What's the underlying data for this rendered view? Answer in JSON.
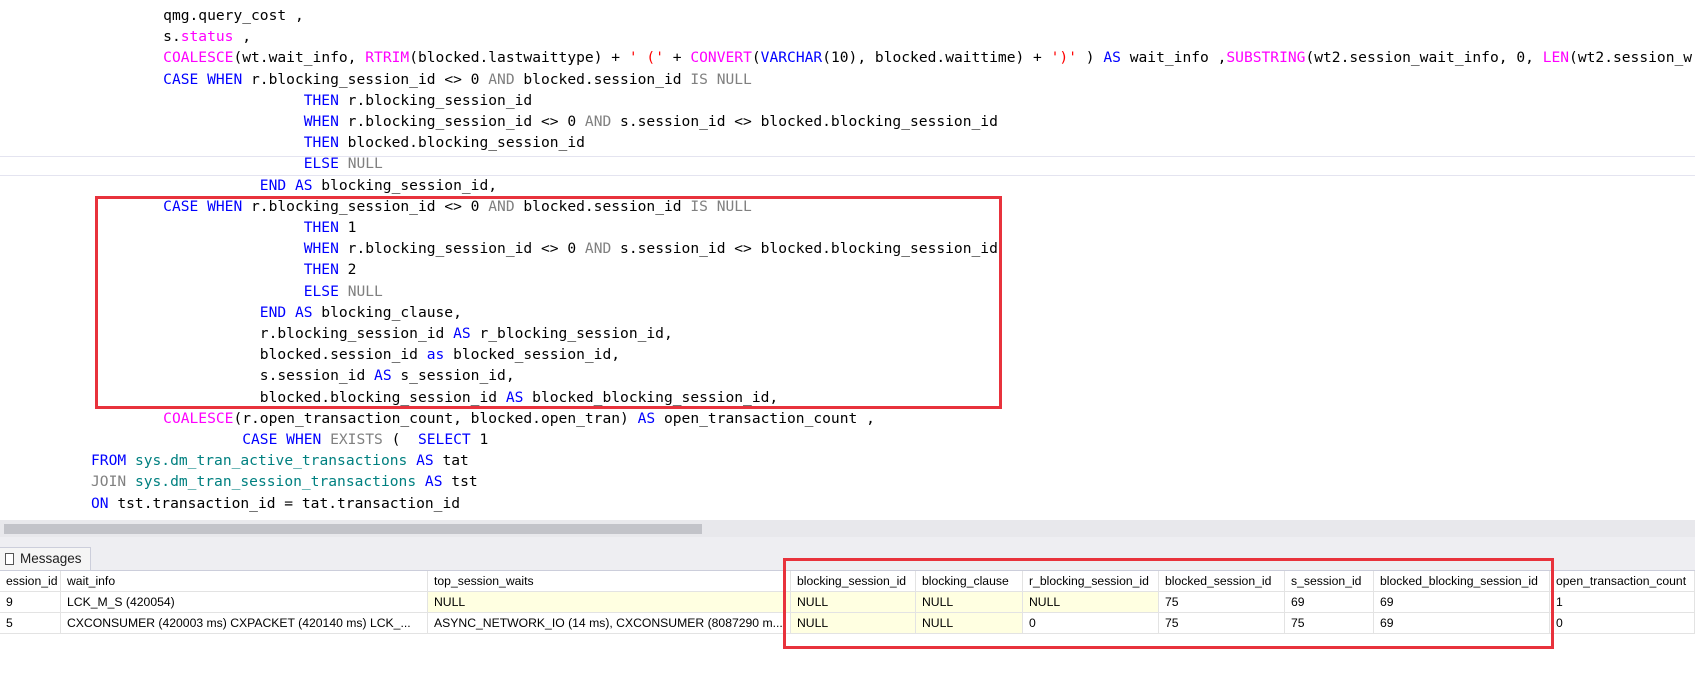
{
  "editor": {
    "lines": [
      [
        {
          "t": "    ",
          "c": "id"
        },
        {
          "t": "qmg.query_cost ,",
          "c": "id"
        }
      ],
      [
        {
          "t": "    ",
          "c": "id"
        },
        {
          "t": "s.",
          "c": "id"
        },
        {
          "t": "status",
          "c": "fn"
        },
        {
          "t": " ,",
          "c": "id"
        }
      ],
      [
        {
          "t": "    ",
          "c": "id"
        },
        {
          "t": "COALESCE",
          "c": "fn"
        },
        {
          "t": "(wt.wait_info, ",
          "c": "id"
        },
        {
          "t": "RTRIM",
          "c": "fn"
        },
        {
          "t": "(blocked.lastwaittype) + ",
          "c": "id"
        },
        {
          "t": "' ('",
          "c": "str"
        },
        {
          "t": " + ",
          "c": "id"
        },
        {
          "t": "CONVERT",
          "c": "fn"
        },
        {
          "t": "(",
          "c": "id"
        },
        {
          "t": "VARCHAR",
          "c": "kw"
        },
        {
          "t": "(10), blocked.waittime) + ",
          "c": "id"
        },
        {
          "t": "')'",
          "c": "str"
        },
        {
          "t": " ) ",
          "c": "id"
        },
        {
          "t": "AS",
          "c": "kw"
        },
        {
          "t": " wait_info ,",
          "c": "id"
        },
        {
          "t": "SUBSTRING",
          "c": "fn"
        },
        {
          "t": "(wt2.session_wait_info, 0, ",
          "c": "id"
        },
        {
          "t": "LEN",
          "c": "fn"
        },
        {
          "t": "(wt2.session_w",
          "c": "id"
        }
      ],
      [
        {
          "t": "    ",
          "c": "id"
        },
        {
          "t": "CASE WHEN",
          "c": "kw"
        },
        {
          "t": " r.blocking_session_id <> 0 ",
          "c": "id"
        },
        {
          "t": "AND",
          "c": "gray"
        },
        {
          "t": " blocked.session_id ",
          "c": "id"
        },
        {
          "t": "IS NULL",
          "c": "gray"
        }
      ],
      [
        {
          "t": "                    ",
          "c": "id"
        },
        {
          "t": "THEN",
          "c": "kw"
        },
        {
          "t": " r.blocking_session_id",
          "c": "id"
        }
      ],
      [
        {
          "t": "                    ",
          "c": "id"
        },
        {
          "t": "WHEN",
          "c": "kw"
        },
        {
          "t": " r.blocking_session_id <> 0 ",
          "c": "id"
        },
        {
          "t": "AND",
          "c": "gray"
        },
        {
          "t": " s.session_id <> blocked.blocking_session_id",
          "c": "id"
        }
      ],
      [
        {
          "t": "                    ",
          "c": "id"
        },
        {
          "t": "THEN",
          "c": "kw"
        },
        {
          "t": " blocked.blocking_session_id",
          "c": "id"
        }
      ],
      [
        {
          "t": "                    ",
          "c": "id"
        },
        {
          "t": "ELSE",
          "c": "kw"
        },
        {
          "t": " ",
          "c": "id"
        },
        {
          "t": "NULL",
          "c": "gray"
        }
      ],
      [
        {
          "t": "               ",
          "c": "id"
        },
        {
          "t": "END AS",
          "c": "kw"
        },
        {
          "t": " blocking_session_id,",
          "c": "id"
        }
      ],
      [
        {
          "t": "    ",
          "c": "id"
        },
        {
          "t": "CASE WHEN",
          "c": "kw"
        },
        {
          "t": " r.blocking_session_id <> 0 ",
          "c": "id"
        },
        {
          "t": "AND",
          "c": "gray"
        },
        {
          "t": " blocked.session_id ",
          "c": "id"
        },
        {
          "t": "IS NULL",
          "c": "gray"
        }
      ],
      [
        {
          "t": "                    ",
          "c": "id"
        },
        {
          "t": "THEN",
          "c": "kw"
        },
        {
          "t": " 1",
          "c": "id"
        }
      ],
      [
        {
          "t": "                    ",
          "c": "id"
        },
        {
          "t": "WHEN",
          "c": "kw"
        },
        {
          "t": " r.blocking_session_id <> 0 ",
          "c": "id"
        },
        {
          "t": "AND",
          "c": "gray"
        },
        {
          "t": " s.session_id <> blocked.blocking_session_id",
          "c": "id"
        }
      ],
      [
        {
          "t": "                    ",
          "c": "id"
        },
        {
          "t": "THEN",
          "c": "kw"
        },
        {
          "t": " 2",
          "c": "id"
        }
      ],
      [
        {
          "t": "                    ",
          "c": "id"
        },
        {
          "t": "ELSE",
          "c": "kw"
        },
        {
          "t": " ",
          "c": "id"
        },
        {
          "t": "NULL",
          "c": "gray"
        }
      ],
      [
        {
          "t": "               ",
          "c": "id"
        },
        {
          "t": "END AS",
          "c": "kw"
        },
        {
          "t": " blocking_clause,",
          "c": "id"
        }
      ],
      [
        {
          "t": "               ",
          "c": "id"
        },
        {
          "t": "r.blocking_session_id ",
          "c": "id"
        },
        {
          "t": "AS",
          "c": "kw"
        },
        {
          "t": " r_blocking_session_id,",
          "c": "id"
        }
      ],
      [
        {
          "t": "               ",
          "c": "id"
        },
        {
          "t": "blocked.session_id ",
          "c": "id"
        },
        {
          "t": "as",
          "c": "kw"
        },
        {
          "t": " blocked_session_id,",
          "c": "id"
        }
      ],
      [
        {
          "t": "               ",
          "c": "id"
        },
        {
          "t": "s.session_id ",
          "c": "id"
        },
        {
          "t": "AS",
          "c": "kw"
        },
        {
          "t": " s_session_id,",
          "c": "id"
        }
      ],
      [
        {
          "t": "               ",
          "c": "id"
        },
        {
          "t": "blocked.blocking_session_id ",
          "c": "id"
        },
        {
          "t": "AS",
          "c": "kw"
        },
        {
          "t": " blocked_blocking_session_id,",
          "c": "id"
        }
      ],
      [
        {
          "t": "    ",
          "c": "id"
        },
        {
          "t": "COALESCE",
          "c": "fn"
        },
        {
          "t": "(r.open_transaction_count, blocked.open_tran) ",
          "c": "id"
        },
        {
          "t": "AS",
          "c": "kw"
        },
        {
          "t": " open_transaction_count ,",
          "c": "id"
        }
      ],
      [
        {
          "t": "             ",
          "c": "id"
        },
        {
          "t": "CASE WHEN",
          "c": "kw"
        },
        {
          "t": " ",
          "c": "id"
        },
        {
          "t": "EXISTS",
          "c": "gray"
        },
        {
          "t": " (  ",
          "c": "id"
        },
        {
          "t": "SELECT",
          "c": "kw"
        },
        {
          "t": " 1",
          "c": "id"
        }
      ],
      [
        {
          "t": "",
          "c": "id"
        },
        {
          "t": "FROM",
          "c": "kw"
        },
        {
          "t": " ",
          "c": "id"
        },
        {
          "t": "sys.dm_tran_active_transactions",
          "c": "obj"
        },
        {
          "t": " ",
          "c": "id"
        },
        {
          "t": "AS",
          "c": "kw"
        },
        {
          "t": " tat",
          "c": "id"
        }
      ],
      [
        {
          "t": "",
          "c": "id"
        },
        {
          "t": "JOIN",
          "c": "gray"
        },
        {
          "t": " ",
          "c": "id"
        },
        {
          "t": "sys.dm_tran_session_transactions",
          "c": "obj"
        },
        {
          "t": " ",
          "c": "id"
        },
        {
          "t": "AS",
          "c": "kw"
        },
        {
          "t": " tst",
          "c": "id"
        }
      ],
      [
        {
          "t": "",
          "c": "id"
        },
        {
          "t": "ON",
          "c": "kw"
        },
        {
          "t": " tst.transaction_id = tat.transaction_id",
          "c": "id"
        }
      ]
    ]
  },
  "results": {
    "tab_label": "Messages",
    "columns": [
      "ession_id",
      "wait_info",
      "top_session_waits",
      "blocking_session_id",
      "blocking_clause",
      "r_blocking_session_id",
      "blocked_session_id",
      "s_session_id",
      "blocked_blocking_session_id",
      "open_transaction_count"
    ],
    "rows": [
      [
        "9",
        "LCK_M_S (420054)",
        "NULL",
        "NULL",
        "NULL",
        "NULL",
        "75",
        "69",
        "69",
        "1"
      ],
      [
        "5",
        "CXCONSUMER (420003 ms) CXPACKET (420140 ms) LCK_...",
        "ASYNC_NETWORK_IO (14 ms), CXCONSUMER (8087290 m...",
        "NULL",
        "NULL",
        "0",
        "75",
        "75",
        "69",
        "0"
      ]
    ]
  },
  "colors": {
    "keyword": "#0000ff",
    "function": "#ff00ff",
    "string": "#ff0000",
    "comparison": "#808080",
    "object": "#008080",
    "highlight_box": "#e8323c",
    "null_cell": "#ffffe1"
  }
}
